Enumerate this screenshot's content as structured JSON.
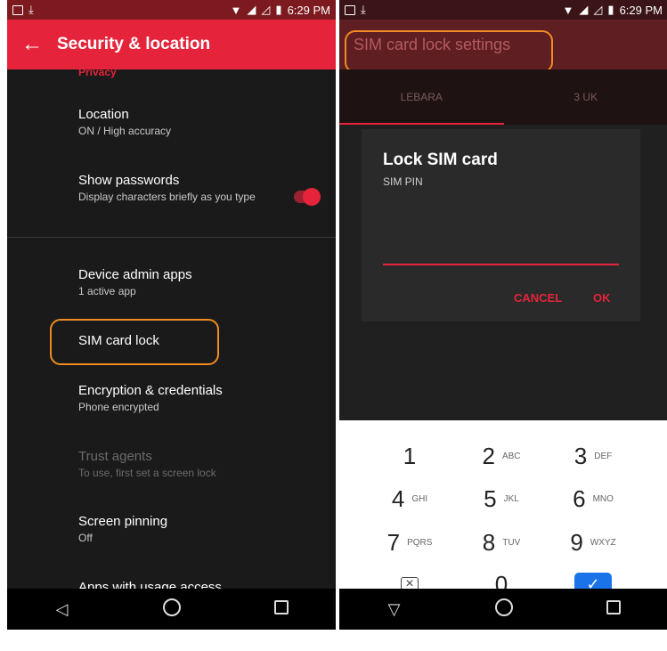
{
  "status": {
    "time": "6:29 PM"
  },
  "left": {
    "title": "Security & location",
    "section_header": "Privacy",
    "items": [
      {
        "title": "Location",
        "subtitle": "ON / High accuracy"
      },
      {
        "title": "Show passwords",
        "subtitle": "Display characters briefly as you type",
        "toggle_on": true
      },
      {
        "title": "Device admin apps",
        "subtitle": "1 active app"
      },
      {
        "title": "SIM card lock",
        "subtitle": ""
      },
      {
        "title": "Encryption & credentials",
        "subtitle": "Phone encrypted"
      },
      {
        "title": "Trust agents",
        "subtitle": "To use, first set a screen lock",
        "disabled": true
      },
      {
        "title": "Screen pinning",
        "subtitle": "Off"
      },
      {
        "title": "Apps with usage access",
        "subtitle": ""
      }
    ]
  },
  "right": {
    "title": "SIM card lock settings",
    "tabs": [
      "LEBARA",
      "3 UK"
    ],
    "dialog": {
      "title": "Lock SIM card",
      "subtitle": "SIM PIN",
      "input_value": "",
      "cancel": "CANCEL",
      "ok": "OK"
    },
    "keypad": [
      {
        "n": "1",
        "l": ""
      },
      {
        "n": "2",
        "l": "ABC"
      },
      {
        "n": "3",
        "l": "DEF"
      },
      {
        "n": "4",
        "l": "GHI"
      },
      {
        "n": "5",
        "l": "JKL"
      },
      {
        "n": "6",
        "l": "MNO"
      },
      {
        "n": "7",
        "l": "PQRS"
      },
      {
        "n": "8",
        "l": "TUV"
      },
      {
        "n": "9",
        "l": "WXYZ"
      },
      {
        "n": "",
        "l": ""
      },
      {
        "n": "0",
        "l": ""
      },
      {
        "n": "",
        "l": ""
      }
    ],
    "keypad_icons": {
      "delete": "backspace-icon",
      "ok": "check-icon"
    }
  },
  "colors": {
    "accent": "#e5243b",
    "highlight": "#f08c22",
    "keypad_ok": "#1a73e8"
  }
}
